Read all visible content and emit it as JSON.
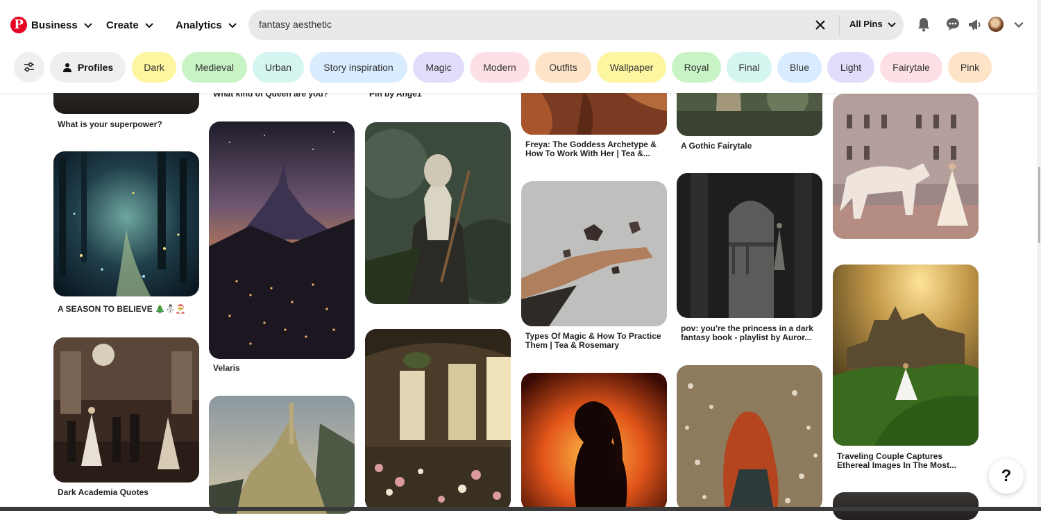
{
  "nav": {
    "business": "Business",
    "create": "Create",
    "analytics": "Analytics"
  },
  "search": {
    "query": "fantasy aesthetic",
    "scope": "All Pins"
  },
  "filters": {
    "profiles": "Profiles",
    "chips": [
      {
        "label": "Dark",
        "color": "#fdf5a0"
      },
      {
        "label": "Medieval",
        "color": "#c8f3c4"
      },
      {
        "label": "Urban",
        "color": "#d4f5f0"
      },
      {
        "label": "Story inspiration",
        "color": "#d9ebff"
      },
      {
        "label": "Magic",
        "color": "#e2dcfa"
      },
      {
        "label": "Modern",
        "color": "#fde0e6"
      },
      {
        "label": "Outfits",
        "color": "#fde3c7"
      },
      {
        "label": "Wallpaper",
        "color": "#fdf5a0"
      },
      {
        "label": "Royal",
        "color": "#c8f3c4"
      },
      {
        "label": "Final",
        "color": "#d4f5f0"
      },
      {
        "label": "Blue",
        "color": "#d9ebff"
      },
      {
        "label": "Light",
        "color": "#e2dcfa"
      },
      {
        "label": "Fairytale",
        "color": "#fde0e6"
      },
      {
        "label": "Pink",
        "color": "#fde3c7"
      }
    ]
  },
  "pins": {
    "col1": [
      {
        "title": "What is your superpower?"
      },
      {
        "title": "A SEASON TO BELIEVE 🎄⛄🎅"
      },
      {
        "title": "Dark Academia Quotes"
      }
    ],
    "col2": [
      {
        "title": "What kind of Queen are you?"
      },
      {
        "title": "Velaris"
      },
      {
        "title": ""
      }
    ],
    "col3": [
      {
        "title": "Pin by Ange1"
      },
      {
        "title": ""
      },
      {
        "title": ""
      }
    ],
    "col4": [
      {
        "title": "Freya: The Goddess Archetype & How To Work With Her | Tea &..."
      },
      {
        "title": "Types Of Magic & How To Practice Them | Tea & Rosemary"
      },
      {
        "title": ""
      }
    ],
    "col5": [
      {
        "title": "A Gothic Fairytale"
      },
      {
        "title": "pov: you're the princess in a dark fantasy book - playlist by Auror..."
      },
      {
        "title": ""
      }
    ],
    "col6": [
      {
        "title": ""
      },
      {
        "title": "Traveling Couple Captures Ethereal Images In The Most..."
      },
      {
        "title": ""
      }
    ]
  },
  "help": {
    "label": "?"
  }
}
